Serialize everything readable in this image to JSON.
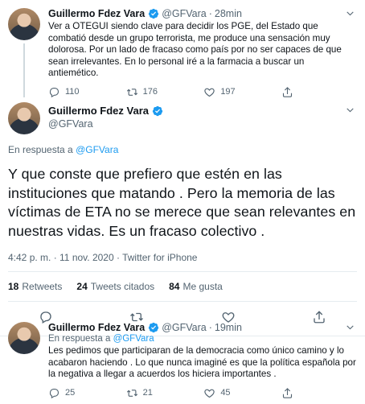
{
  "tweet1": {
    "name": "Guillermo Fdez Vara",
    "handle": "@GFVara",
    "time": "28min",
    "text": "Ver a OTEGUI siendo clave para decidir los PGE,  del Estado que combatió desde un grupo terrorista,  me produce  una sensación muy dolorosa. Por un lado de fracaso como país por no ser capaces de que sean irrelevantes. En lo personal iré a la farmacia a buscar un antiemético.",
    "replies": "110",
    "retweets": "176",
    "likes": "197"
  },
  "main": {
    "name": "Guillermo Fdez Vara",
    "handle": "@GFVara",
    "reply_prefix": "En respuesta a",
    "reply_handle": "@GFVara",
    "text": "Y que conste que prefiero que estén en las instituciones que matando . Pero la memoria de las víctimas de ETA no se merece que sean relevantes en nuestras vidas. Es un fracaso colectivo .",
    "meta": "4:42 p. m. · 11 nov. 2020 · Twitter for iPhone",
    "retweets_count": "18",
    "retweets_label": "Retweets",
    "quotes_count": "24",
    "quotes_label": "Tweets citados",
    "likes_count": "84",
    "likes_label": "Me gusta"
  },
  "tweet3": {
    "name": "Guillermo Fdez Vara",
    "handle": "@GFVara",
    "time": "19min",
    "reply_prefix": "En respuesta a",
    "reply_handle": "@GFVara",
    "text": "Les pedimos que participaran de la democracia como único camino y lo acabaron haciendo . Lo que nunca imaginé es que la política española por la negativa a llegar a acuerdos los hiciera importantes .",
    "replies": "25",
    "retweets": "21",
    "likes": "45"
  },
  "colors": {
    "accent": "#1d9bf0",
    "secondary": "#536471",
    "divider": "#e6ecf0"
  }
}
